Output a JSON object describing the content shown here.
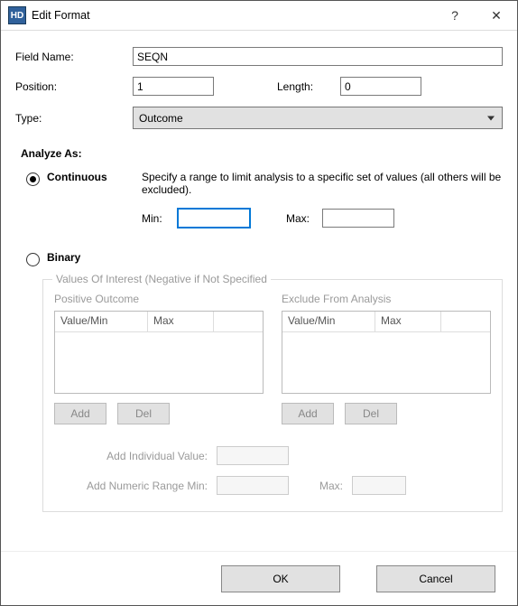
{
  "window": {
    "app_icon_text": "HD",
    "title": "Edit Format",
    "help_glyph": "?",
    "close_glyph": "✕"
  },
  "labels": {
    "field_name": "Field Name:",
    "position": "Position:",
    "length": "Length:",
    "type": "Type:",
    "analyze_as": "Analyze As:"
  },
  "values": {
    "field_name": "SEQN",
    "position": "1",
    "length": "0",
    "type": "Outcome"
  },
  "continuous": {
    "radio_label": "Continuous",
    "desc": "Specify a range to limit analysis to a specific set of values (all others will be excluded).",
    "min_label": "Min:",
    "max_label": "Max:",
    "min_value": "",
    "max_value": ""
  },
  "binary": {
    "radio_label": "Binary"
  },
  "groupbox": {
    "title": "Values Of Interest (Negative if Not Specified",
    "left_title": "Positive Outcome",
    "right_title": "Exclude From Analysis",
    "col_value": "Value/Min",
    "col_max": "Max",
    "add": "Add",
    "del": "Del",
    "add_individual": "Add Individual Value:",
    "add_range_min": "Add Numeric Range Min:",
    "add_range_max": "Max:"
  },
  "buttons": {
    "ok": "OK",
    "cancel": "Cancel"
  }
}
